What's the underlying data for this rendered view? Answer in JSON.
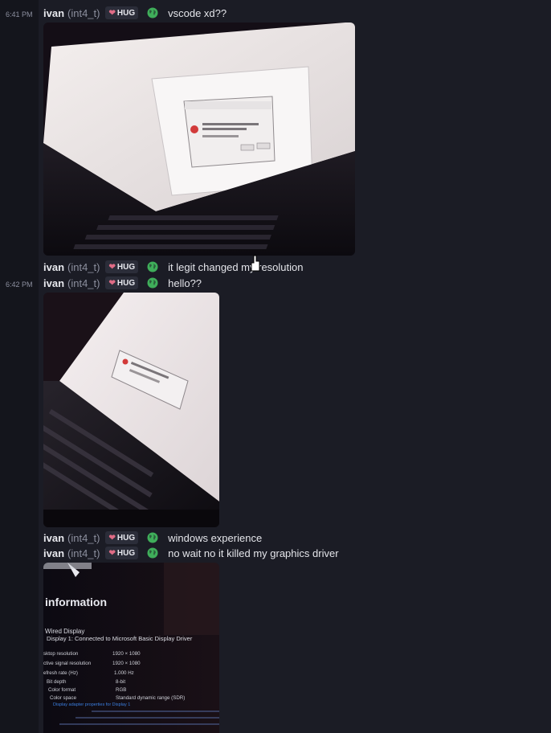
{
  "timestamps": [
    "6:41 PM",
    "6:42 PM"
  ],
  "user": {
    "name": "ivan",
    "handle": "(int4_t)",
    "badge": "HUG"
  },
  "messages": [
    {
      "text": "vscode xd??"
    },
    {
      "text": "it legit changed my resolution"
    },
    {
      "text": "hello??"
    },
    {
      "text": "windows experience"
    },
    {
      "text": "no wait no it killed my graphics driver"
    }
  ],
  "photo3": {
    "heading": "information",
    "display_title": "Wired Display",
    "display_sub": "Display 1: Connected to Microsoft Basic Display Driver",
    "rows": [
      {
        "label": "sktop resolution",
        "value": "1920 × 1080"
      },
      {
        "label": "ctive signal resolution",
        "value": "1920 × 1080"
      },
      {
        "label": "efresh rate (Hz)",
        "value": "1.000 Hz"
      },
      {
        "label": "Bit depth",
        "value": "8-bit"
      },
      {
        "label": "Color format",
        "value": "RGB"
      },
      {
        "label": "Color space",
        "value": "Standard dynamic range (SDR)"
      }
    ],
    "link": "Display adapter properties for Display 1"
  },
  "icons": [
    "heart-icon",
    "globe-icon",
    "mouse-cursor-icon"
  ],
  "colors": {
    "badge_heart": "#e06c86",
    "globe": "#3fae5a",
    "main_bg": "#1b1c25"
  }
}
